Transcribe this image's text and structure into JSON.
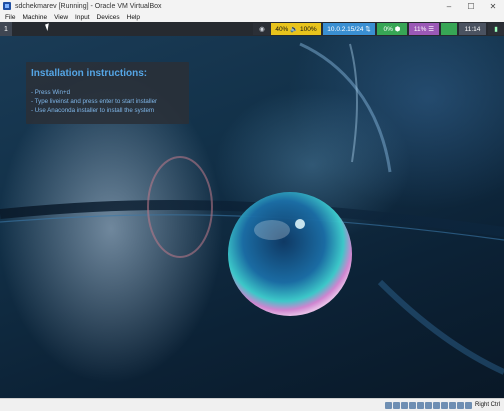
{
  "window": {
    "title": "sdchekmarev [Running] - Oracle VM VirtualBox",
    "controls": {
      "minimize": "–",
      "maximize": "☐",
      "close": "✕"
    }
  },
  "menubar": {
    "items": [
      "File",
      "Machine",
      "View",
      "Input",
      "Devices",
      "Help"
    ]
  },
  "topbar": {
    "workspace": "1",
    "volume": "40% 🔈 100%",
    "network": "10.0.2.15/24 ⇅",
    "cpu": "0% ⬢",
    "memory": "11% ☰",
    "clock": "11:14"
  },
  "instructions": {
    "title": "Installation instructions:",
    "lines": [
      "- Press   Win+d",
      "- Type   liveinst   and press enter to start installer",
      "- Use Anaconda installer to install the system"
    ]
  },
  "statusbar": {
    "host_key": "Right Ctrl",
    "icons": [
      "hdd-icon",
      "optical-icon",
      "audio-icon",
      "network-icon",
      "usb-icon",
      "shared-folder-icon",
      "display-icon",
      "capture-icon",
      "cpu-icon",
      "mouse-icon",
      "keyboard-icon"
    ]
  }
}
